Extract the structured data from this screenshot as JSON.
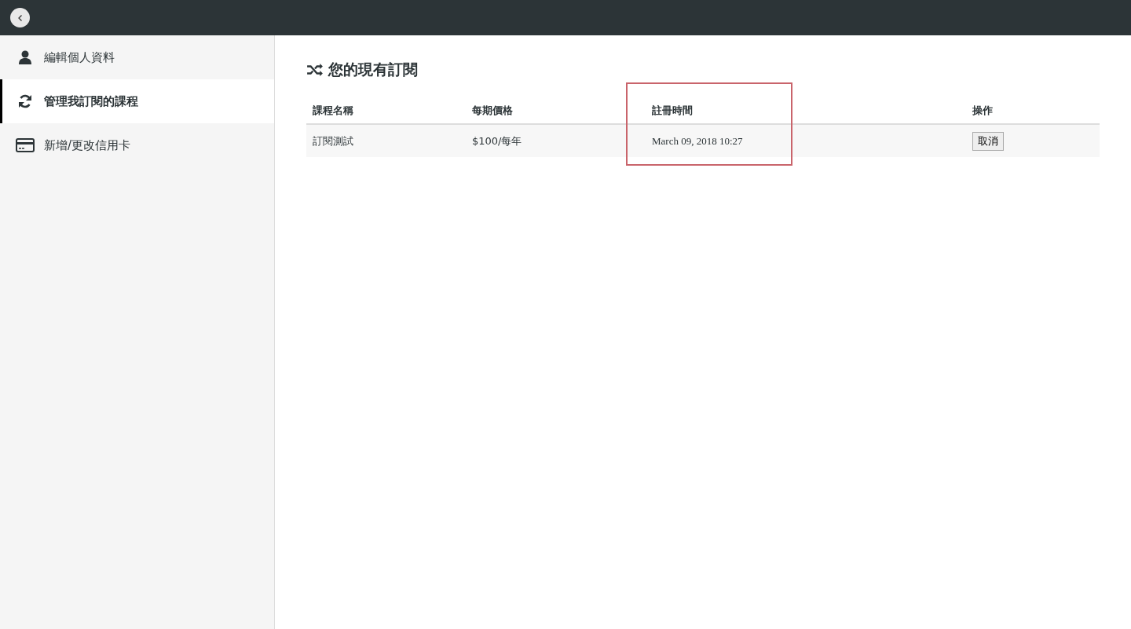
{
  "sidebar": {
    "items": [
      {
        "kind": "user",
        "label": "編輯個人資料",
        "selected": false
      },
      {
        "kind": "sync",
        "label": "管理我訂閱的課程",
        "selected": true
      },
      {
        "kind": "card",
        "label": "新增/更改信用卡",
        "selected": false
      }
    ]
  },
  "main": {
    "title": "您的現有訂閱",
    "table": {
      "columns": [
        "課程名稱",
        "每期價格",
        "註冊時間",
        "操作"
      ],
      "rows": [
        {
          "name": "訂閱測試",
          "price": "$100/每年",
          "registered": "March 09, 2018 10:27",
          "action": "取消"
        }
      ]
    }
  }
}
